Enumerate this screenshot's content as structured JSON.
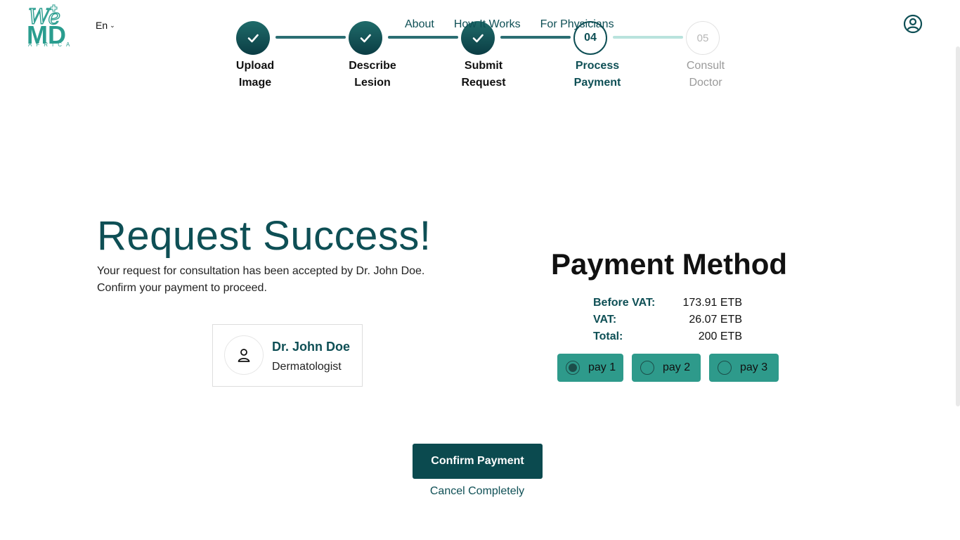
{
  "header": {
    "logo_text": "WeMD",
    "logo_subtext": "AFRICA",
    "language": "En",
    "nav": [
      {
        "label": "About"
      },
      {
        "label": "How It Works"
      },
      {
        "label": "For Physicians"
      }
    ]
  },
  "stepper": {
    "steps": [
      {
        "line1": "Upload",
        "line2": "Image",
        "state": "done"
      },
      {
        "line1": "Describe",
        "line2": "Lesion",
        "state": "done"
      },
      {
        "line1": "Submit",
        "line2": "Request",
        "state": "done"
      },
      {
        "number": "04",
        "line1": "Process",
        "line2": "Payment",
        "state": "active"
      },
      {
        "number": "05",
        "line1": "Consult",
        "line2": "Doctor",
        "state": "pending"
      }
    ]
  },
  "main": {
    "title": "Request Success!",
    "description_line1": "Your request for consultation has been accepted by Dr. John Doe.",
    "description_line2": "Confirm your payment to proceed.",
    "doctor": {
      "name": "Dr. John Doe",
      "specialty": "Dermatologist"
    }
  },
  "payment": {
    "title": "Payment Method",
    "before_vat_label": "Before VAT:",
    "before_vat_value": "173.91 ETB",
    "vat_label": "VAT:",
    "vat_value": "26.07 ETB",
    "total_label": "Total:",
    "total_value": "200 ETB",
    "options": [
      {
        "label": "pay 1",
        "selected": true
      },
      {
        "label": "pay 2",
        "selected": false
      },
      {
        "label": "pay 3",
        "selected": false
      }
    ]
  },
  "actions": {
    "confirm_label": "Confirm Payment",
    "cancel_label": "Cancel Completely"
  },
  "colors": {
    "primary": "#0e4f55",
    "accent": "#2e9a8b",
    "button": "#0b4a4f"
  }
}
